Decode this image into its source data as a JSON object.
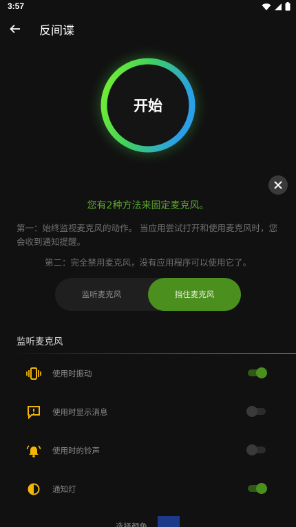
{
  "status_bar": {
    "time": "3:57",
    "icons": [
      "wifi-icon",
      "signal-icon",
      "battery-icon"
    ]
  },
  "app_bar": {
    "title": "反间谍",
    "back_icon": "arrow-left-icon"
  },
  "main_button": {
    "label": "开始"
  },
  "info": {
    "headline": "您有2种方法来固定麦克风。",
    "desc1": "第一：始终监视麦克风的动作。 当应用尝试打开和使用麦克风时，您会收到通知提醒。",
    "desc2": "第二：完全禁用麦克风，没有应用程序可以使用它了。"
  },
  "segmented": {
    "left": "监听麦克风",
    "right": "挡住麦克风",
    "selected": "right"
  },
  "section": {
    "title": "监听麦克风"
  },
  "settings": [
    {
      "label": "使用时振动",
      "icon": "vibrate-icon",
      "enabled": true
    },
    {
      "label": "使用时显示消息",
      "icon": "message-alert-icon",
      "enabled": false
    },
    {
      "label": "使用时的铃声",
      "icon": "bell-icon",
      "enabled": false
    },
    {
      "label": "通知灯",
      "icon": "light-contrast-icon",
      "enabled": true
    }
  ],
  "bottom": {
    "label": "选择颜色",
    "swatch_color": "#1d3a8a"
  },
  "colors": {
    "accent": "#4b8f1e",
    "headline": "#5aa52c",
    "icon_yellow": "#f2b705",
    "background": "#111111"
  }
}
